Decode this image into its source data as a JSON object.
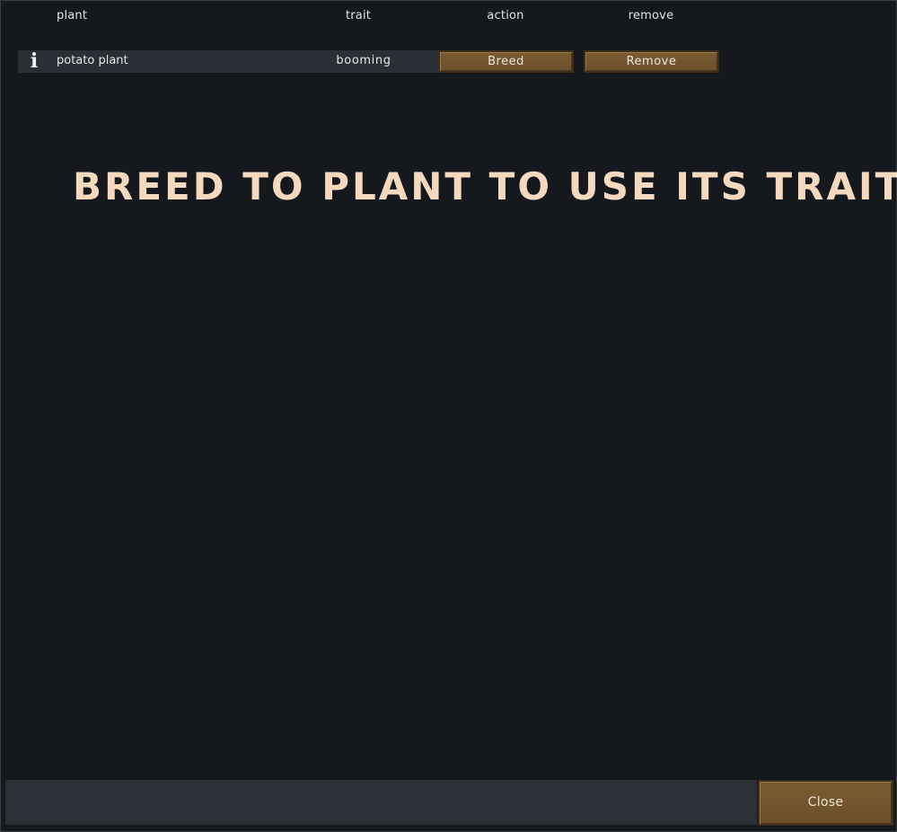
{
  "table": {
    "headers": {
      "plant": "plant",
      "trait": "trait",
      "action": "action",
      "remove": "remove"
    },
    "rows": [
      {
        "icon": "info-icon",
        "plant": "potato plant",
        "trait": "booming",
        "action_label": "Breed",
        "remove_label": "Remove"
      }
    ]
  },
  "banner": {
    "text": "BREED TO PLANT TO USE ITS TRAIT"
  },
  "footer": {
    "close_label": "Close"
  },
  "colors": {
    "background": "#15181d",
    "row_background": "#2a2e35",
    "button": "#6b4f2a",
    "banner_text": "#f4d9bf"
  }
}
